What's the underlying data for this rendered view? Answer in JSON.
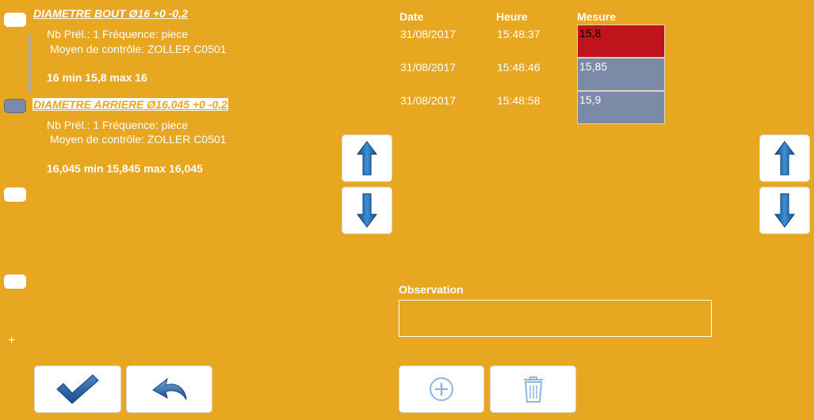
{
  "characteristics": [
    {
      "title": "DIAMETRE BOUT Ø16 +0 -0,2",
      "sampling": "Nb Prél.: 1 Fréquence: piece",
      "control": "Moyen de contrôle: ZOLLER C0501",
      "limits": "16 min 15,8 max 16"
    },
    {
      "title": "DIAMETRE ARRIERE Ø16,045 +0 -0,2",
      "sampling": "Nb Prél.: 1 Fréquence: piece",
      "control": "Moyen de contrôle: ZOLLER C0501",
      "limits": "16,045 min 15,845 max 16,045"
    }
  ],
  "sidebar_add": "+",
  "table": {
    "headers": {
      "date": "Date",
      "time": "Heure",
      "measure": "Mesure"
    },
    "rows": [
      {
        "date": "31/08/2017",
        "time": "15:48:37",
        "value": "15,8",
        "status": "out"
      },
      {
        "date": "31/08/2017",
        "time": "15:48:46",
        "value": "15,85",
        "status": "ok"
      },
      {
        "date": "31/08/2017",
        "time": "15:48:58",
        "value": "15,9",
        "status": "ok"
      }
    ]
  },
  "observation": {
    "label": "Observation",
    "value": ""
  },
  "colors": {
    "background": "#E8A720",
    "out_of_tolerance": "#C0141C",
    "in_tolerance": "#7B8AA7",
    "arrow_blue": "#1E6FB6"
  },
  "icons": {
    "confirm": "checkmark-icon",
    "undo": "undo-arrow-icon",
    "up": "arrow-up-icon",
    "down": "arrow-down-icon",
    "add": "plus-circle-icon",
    "delete": "trash-icon"
  }
}
